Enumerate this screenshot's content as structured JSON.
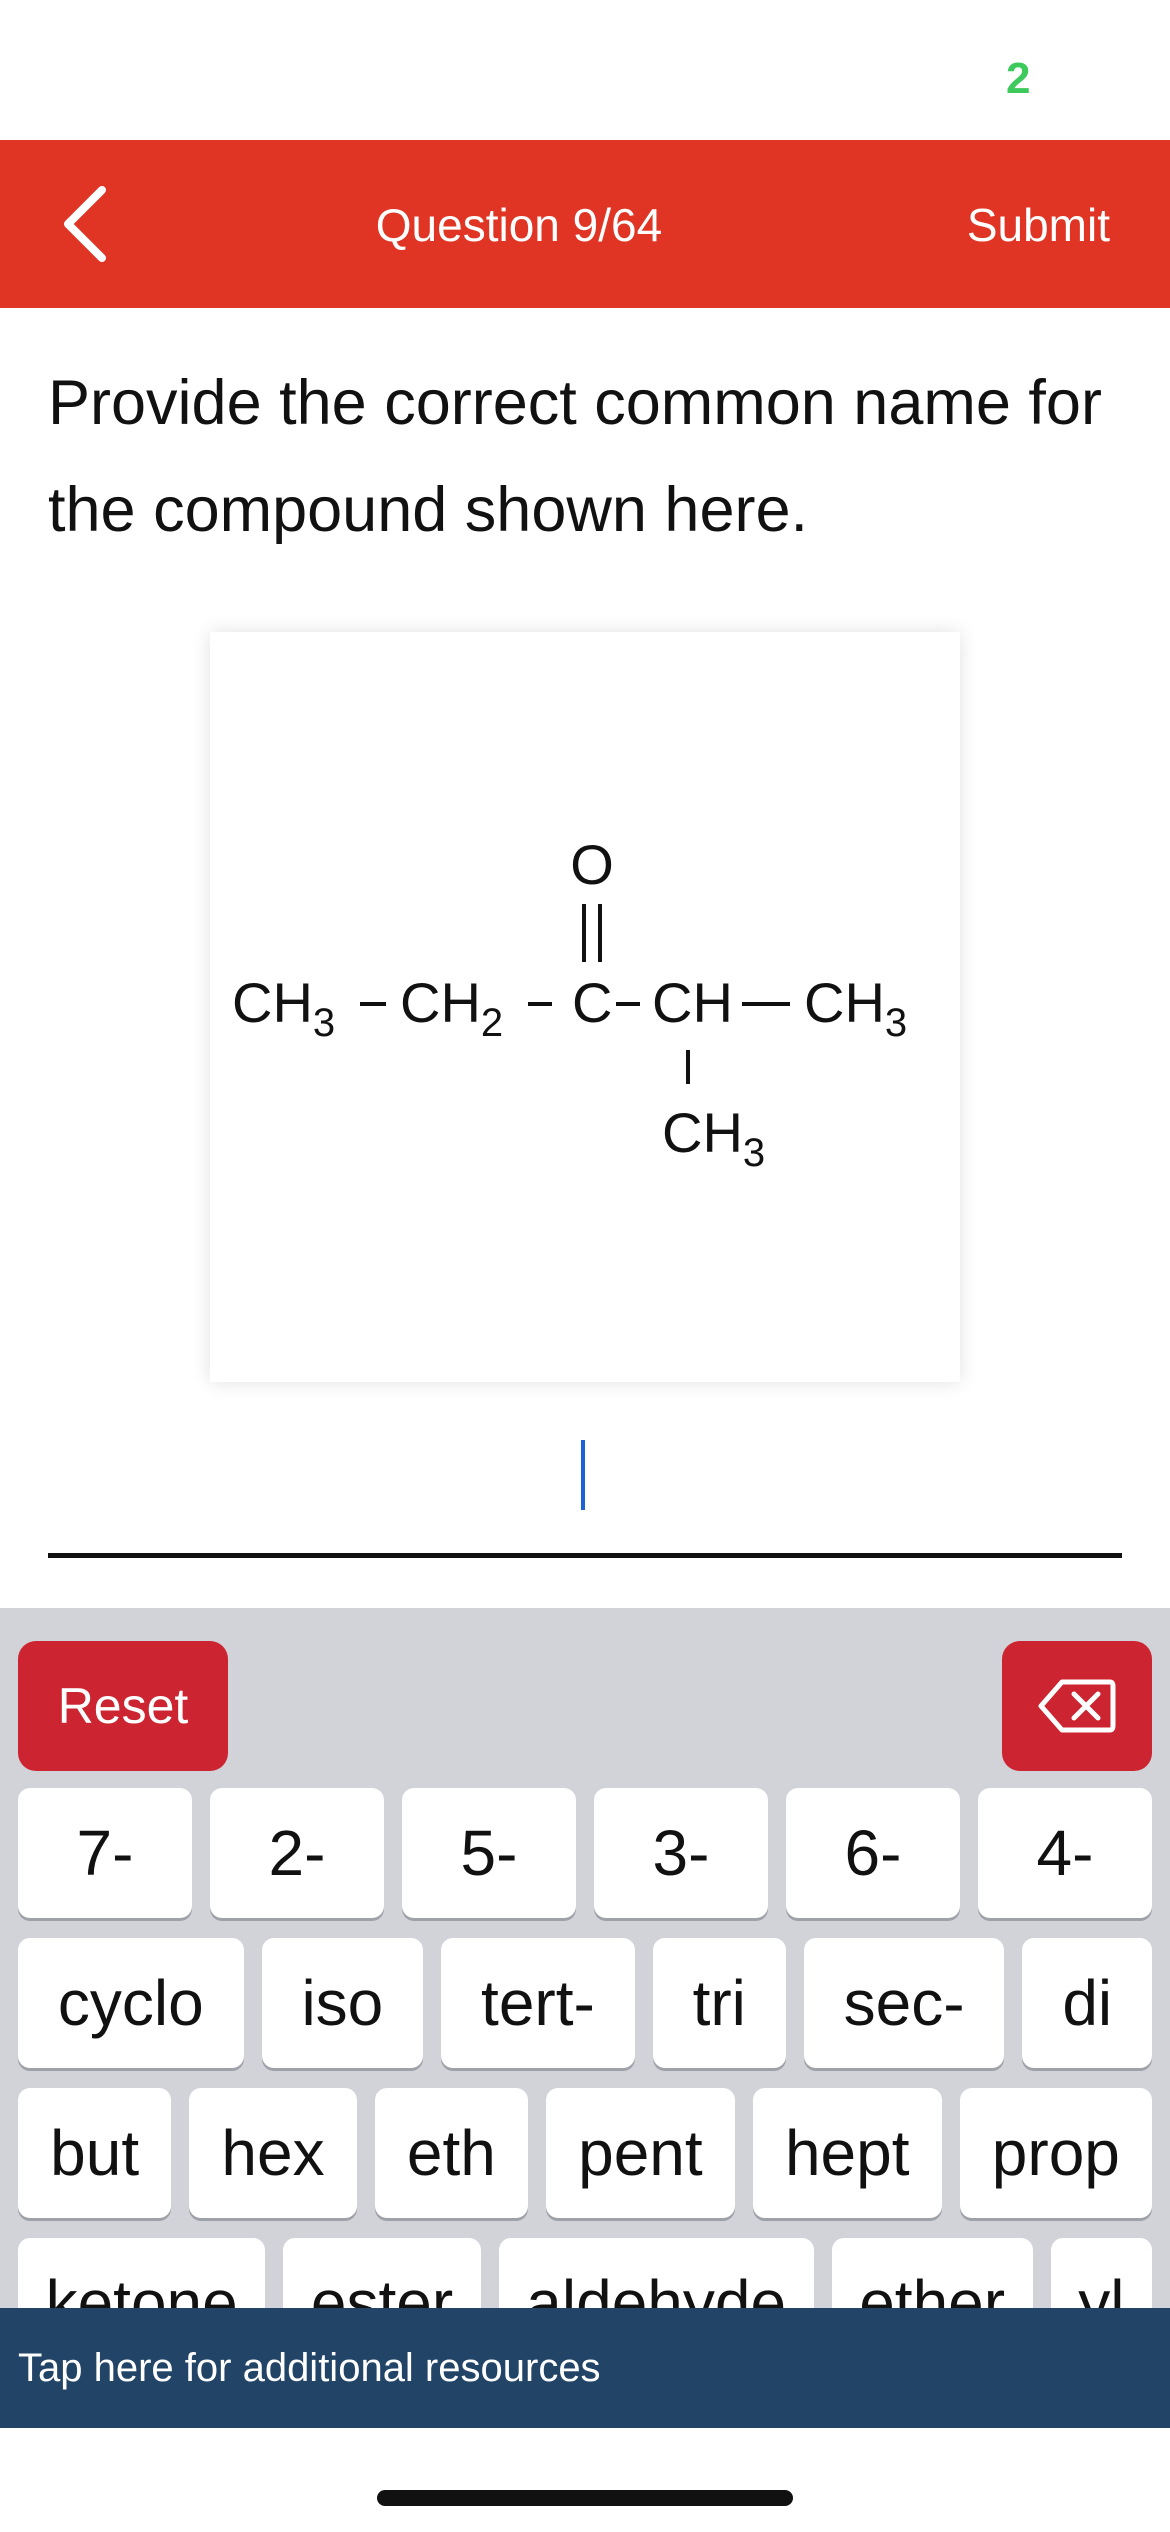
{
  "status": {
    "indicator_glyph": "2"
  },
  "header": {
    "back_icon": "chevron-left-icon",
    "title": "Question 9/64",
    "submit_label": "Submit",
    "background_color": "#e03524"
  },
  "question": {
    "text": "Provide the correct common name for the compound shown here."
  },
  "structure": {
    "carbonyl_oxygen": "O",
    "chain": [
      "CH3",
      "CH2",
      "C",
      "CH",
      "CH3"
    ],
    "branch": "CH3"
  },
  "answer": {
    "value": ""
  },
  "keyboard": {
    "reset_label": "Reset",
    "delete_icon": "backspace-icon",
    "rows": [
      [
        "7-",
        "2-",
        "5-",
        "3-",
        "6-",
        "4-"
      ],
      [
        "cyclo",
        "iso",
        "tert-",
        "tri",
        "sec-",
        "di"
      ],
      [
        "but",
        "hex",
        "eth",
        "pent",
        "hept",
        "prop"
      ],
      [
        "ketone",
        "ester",
        "aldehyde",
        "ether",
        "yl"
      ]
    ]
  },
  "footer": {
    "resources_label": "Tap here for additional resources"
  }
}
